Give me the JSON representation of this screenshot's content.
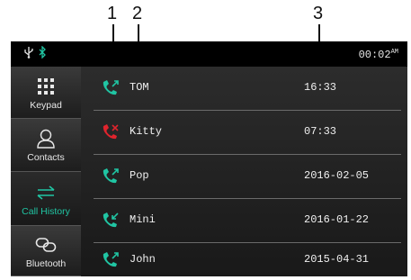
{
  "callouts": [
    "1",
    "2",
    "3"
  ],
  "status": {
    "time": "00:02",
    "ampm": "AM",
    "icons": [
      "usb-icon",
      "bluetooth-icon"
    ]
  },
  "sidebar": {
    "items": [
      {
        "label": "Keypad",
        "icon": "keypad-grid-icon"
      },
      {
        "label": "Contacts",
        "icon": "person-icon"
      },
      {
        "label": "Call History",
        "icon": "swap-arrows-icon",
        "active": true
      },
      {
        "label": "Bluetooth",
        "icon": "link-icon"
      }
    ]
  },
  "calls": [
    {
      "name": "TOM",
      "date": "16:33",
      "type": "outgoing"
    },
    {
      "name": "Kitty",
      "date": "07:33",
      "type": "missed"
    },
    {
      "name": "Pop",
      "date": "2016-02-05",
      "type": "outgoing"
    },
    {
      "name": "Mini",
      "date": "2016-01-22",
      "type": "incoming"
    },
    {
      "name": "John",
      "date": "2015-04-31",
      "type": "outgoing"
    }
  ],
  "colors": {
    "accent": "#20c5a3",
    "missed": "#e0242d",
    "background": "#000000"
  }
}
